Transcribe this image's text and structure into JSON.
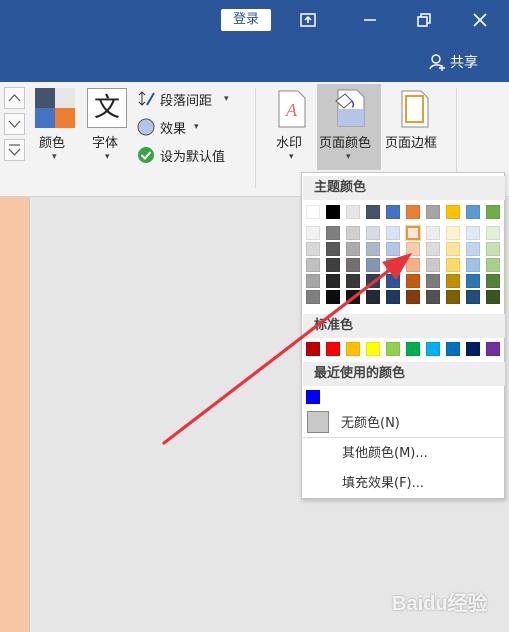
{
  "titlebar": {
    "login_label": "登录",
    "share_label": "共享"
  },
  "ribbon": {
    "colors_label": "颜色",
    "fonts_label": "字体",
    "fonts_glyph": "文",
    "paragraph_spacing_label": "段落间距",
    "effects_label": "效果",
    "set_default_label": "设为默认值",
    "watermark_label": "水印",
    "page_color_label": "页面颜色",
    "page_borders_label": "页面边框"
  },
  "dropdown": {
    "theme_colors_header": "主题颜色",
    "standard_colors_header": "标准色",
    "recent_colors_header": "最近使用的颜色",
    "no_color_label": "无颜色(N)",
    "more_colors_label": "其他颜色(M)...",
    "fill_effects_label": "填充效果(F)...",
    "theme_top_row": [
      "#ffffff",
      "#000000",
      "#e7e6e6",
      "#44546a",
      "#4472c4",
      "#ed7d31",
      "#a5a5a5",
      "#ffc000",
      "#5b9bd5",
      "#70ad47"
    ],
    "theme_shades": [
      [
        "#f2f2f2",
        "#7f7f7f",
        "#d0cece",
        "#d6dce4",
        "#d9e2f3",
        "#fbe5d5",
        "#ededed",
        "#fff2cc",
        "#deeaf6",
        "#e2efd9"
      ],
      [
        "#d8d8d8",
        "#595959",
        "#aeabab",
        "#adb9ca",
        "#b4c6e7",
        "#f7cbac",
        "#dbdbdb",
        "#fee599",
        "#bdd7ee",
        "#c5e0b3"
      ],
      [
        "#bfbfbf",
        "#3f3f3f",
        "#757070",
        "#8496b0",
        "#8eaadb",
        "#f4b183",
        "#c9c9c9",
        "#ffd965",
        "#9cc3e5",
        "#a8d08d"
      ],
      [
        "#a5a5a5",
        "#262626",
        "#3a3838",
        "#323f4f",
        "#2f5496",
        "#c55a11",
        "#7b7b7b",
        "#bf8f00",
        "#2e75b5",
        "#538135"
      ],
      [
        "#7f7f7f",
        "#0c0c0c",
        "#171616",
        "#222a35",
        "#1f3864",
        "#833c0b",
        "#525252",
        "#7f6000",
        "#1e4e79",
        "#375623"
      ]
    ],
    "standard_colors": [
      "#c00000",
      "#ff0000",
      "#ffc000",
      "#ffff00",
      "#92d050",
      "#00b050",
      "#00b0f0",
      "#0070c0",
      "#002060",
      "#7030a0"
    ],
    "recent_colors": [
      "#0000ff"
    ],
    "selected_color": "#fbe5d5"
  },
  "watermark_text": "Baidu经验"
}
